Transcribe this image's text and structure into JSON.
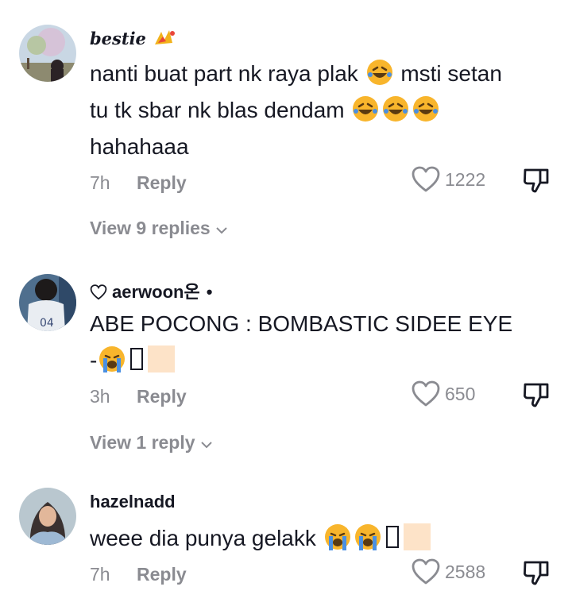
{
  "comments": [
    {
      "username": "bestie",
      "text_line1_a": "nanti buat part nk raya plak",
      "text_line1_b": "msti setan",
      "text_line2": "tu tk sbar nk blas dendam",
      "text_line3": "hahahaaa",
      "time": "7h",
      "reply_label": "Reply",
      "likes": "1222",
      "view_replies": "View 9 replies"
    },
    {
      "username": "aerwoon온",
      "text_line1": "ABE POCONG : BOMBASTIC SIDEE EYE",
      "text_line2": "-",
      "time": "3h",
      "reply_label": "Reply",
      "likes": "650",
      "view_replies": "View 1 reply"
    },
    {
      "username": "hazelnadd",
      "text_line1": "weee dia punya gelakk",
      "time": "7h",
      "reply_label": "Reply",
      "likes": "2588"
    }
  ],
  "icons": {
    "laughing_emoji": "rolling-on-floor-laughing",
    "crying_emoji": "loudly-crying-face",
    "sparkle_emoji": "sparkles-lips",
    "like": "heart-outline-icon",
    "dislike": "thumbs-down-icon",
    "chevron": "chevron-down-icon"
  },
  "colors": {
    "text": "#161823",
    "muted": "#8a8b91",
    "emoji_yellow": "#f8b52c",
    "emoji_tear": "#4a90e2",
    "skin_tone": "#fde3c8"
  }
}
